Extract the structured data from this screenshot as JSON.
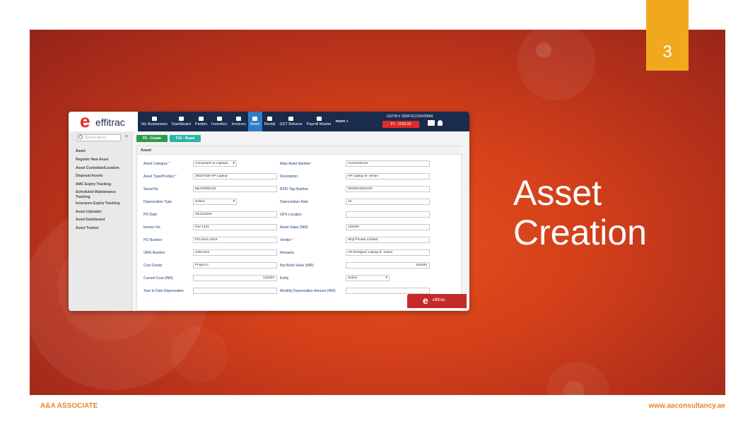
{
  "slide": {
    "number": "3",
    "title_line1": "Asset",
    "title_line2": "Creation",
    "footer_left": "A&A ASSOCIATE",
    "footer_right": "www.aaconsultancy.ae",
    "colors": {
      "banner": "#d3401a",
      "badge": "#f0a81c",
      "footer_text": "#e8862a"
    }
  },
  "app": {
    "logo_mark": "e",
    "logo_text": "effitrac",
    "nav": [
      {
        "label": "My Businesses",
        "icon": "briefcase-icon"
      },
      {
        "label": "Dashboard",
        "icon": "monitor-icon"
      },
      {
        "label": "Parties",
        "icon": "users-icon"
      },
      {
        "label": "Inventory",
        "icon": "box-icon"
      },
      {
        "label": "Invoices",
        "icon": "document-icon"
      },
      {
        "label": "Asset",
        "icon": "asset-icon",
        "active": true
      },
      {
        "label": "Rental",
        "icon": "rental-icon"
      },
      {
        "label": "GST Returns",
        "icon": "gst-icon"
      },
      {
        "label": "Payroll Master",
        "icon": "person-icon"
      },
      {
        "label": "more »",
        "icon": ""
      }
    ],
    "gstin": "GSTIN # 33DFVC2154789A9",
    "fy": "FY : 2019-20",
    "search_placeholder": "Search Menu",
    "sidebar_items": [
      "Asset",
      "Register New Asset",
      "Asset Custodian/Location",
      "Disposal Assets",
      "AMC Expiry Tracking",
      "Scheduled Maintenance",
      "Tracking",
      "Insurance Expiry Tracking",
      "Asset Uploader",
      "Asset Dashboard",
      "Asset Tracker"
    ],
    "buttons": {
      "create": "F5 - Create",
      "reset": "F10 - Reset"
    },
    "panel_title": "Asset",
    "form": {
      "left": [
        {
          "label": "Asset Category",
          "required": true,
          "value": "Computers & Laptops",
          "select": true
        },
        {
          "label": "Asset Type/Product",
          "required": true,
          "value": "30027030-HP Laptop"
        },
        {
          "label": "Serial No",
          "value": "65470092130"
        },
        {
          "label": "Depreciation Type",
          "value": "Select",
          "select": true
        },
        {
          "label": "PO Date",
          "value": "02/11/2018"
        },
        {
          "label": "Invoice No",
          "value": "INV-1231"
        },
        {
          "label": "PO Number",
          "value": "PO-2541-2019"
        },
        {
          "label": "GRN Number",
          "value": "GRN-542"
        },
        {
          "label": "Cost Center",
          "value": "Project-1"
        },
        {
          "label": "Current Cost (INR)",
          "value": "125400",
          "right": true
        },
        {
          "label": "Year to Date Depreciation",
          "value": ""
        }
      ],
      "right": [
        {
          "label": "Alias Asset Number",
          "value": "CL5421D210"
        },
        {
          "label": "Description",
          "value": "HP Laptop E- series"
        },
        {
          "label": "RFID Tag Number",
          "value": "6000021554100"
        },
        {
          "label": "Depreciation Rate",
          "value": "10"
        },
        {
          "label": "GPS Location",
          "value": ""
        },
        {
          "label": "Asset Value (INR)",
          "value": "125400"
        },
        {
          "label": "Vendor",
          "required": true,
          "value": "Skyl Private Limited"
        },
        {
          "label": "Remarks",
          "value": "HP Designer Laptop E- series"
        },
        {
          "label": "Net Book Value (INR)",
          "value": "125400",
          "right": true
        },
        {
          "label": "Entity",
          "value": "Select",
          "select": true
        },
        {
          "label": "Monthly Depreciation Amount (INR)",
          "value": ""
        }
      ]
    }
  }
}
